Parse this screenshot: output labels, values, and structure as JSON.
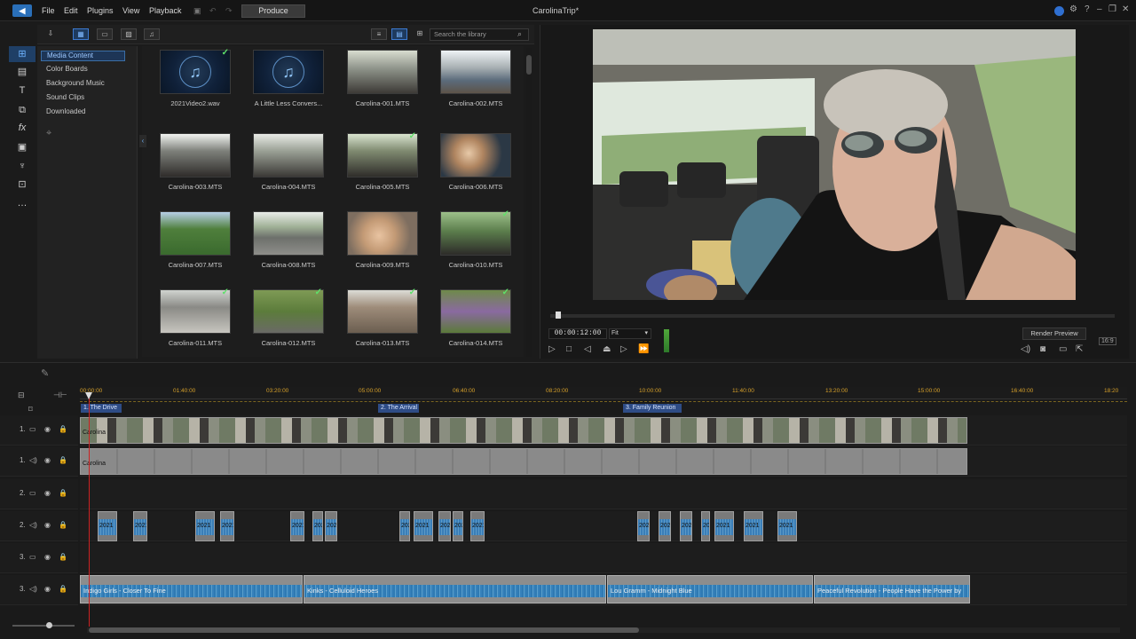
{
  "app": {
    "title": "CarolinaTrip*"
  },
  "menu": {
    "items": [
      "File",
      "Edit",
      "Plugins",
      "View",
      "Playback"
    ],
    "produce": "Produce"
  },
  "library": {
    "tree": [
      "Media Content",
      "Color Boards",
      "Background Music",
      "Sound Clips",
      "Downloaded"
    ],
    "search_placeholder": "Search the library",
    "items": [
      {
        "label": "2021Video2.wav",
        "type": "music"
      },
      {
        "label": "A Little Less Convers...",
        "type": "music"
      },
      {
        "label": "Carolina-001.MTS",
        "type": "video"
      },
      {
        "label": "Carolina-002.MTS",
        "type": "video"
      },
      {
        "label": "Carolina-003.MTS",
        "type": "video"
      },
      {
        "label": "Carolina-004.MTS",
        "type": "video"
      },
      {
        "label": "Carolina-005.MTS",
        "type": "video"
      },
      {
        "label": "Carolina-006.MTS",
        "type": "video"
      },
      {
        "label": "Carolina-007.MTS",
        "type": "video"
      },
      {
        "label": "Carolina-008.MTS",
        "type": "video"
      },
      {
        "label": "Carolina-009.MTS",
        "type": "video"
      },
      {
        "label": "Carolina-010.MTS",
        "type": "video"
      },
      {
        "label": "Carolina-011.MTS",
        "type": "video"
      },
      {
        "label": "Carolina-012.MTS",
        "type": "video"
      },
      {
        "label": "Carolina-013.MTS",
        "type": "video"
      },
      {
        "label": "Carolina-014.MTS",
        "type": "video"
      }
    ]
  },
  "preview": {
    "timecode": "00:00:12:00",
    "fit": "Fit",
    "render_preview": "Render Preview",
    "aspect": "16:9"
  },
  "timeline": {
    "ruler": [
      "00:00:00",
      "01:40:00",
      "03:20:00",
      "05:00:00",
      "06:40:00",
      "08:20:00",
      "10:00:00",
      "11:40:00",
      "13:20:00",
      "15:00:00",
      "16:40:00",
      "18:20"
    ],
    "chapters": [
      "1. The Drive",
      "2. The Arrival",
      "3. Family Reunion"
    ],
    "tracks": [
      "1.",
      "1.",
      "2.",
      "2.",
      "3.",
      "3."
    ],
    "music_clips": [
      "Indigo Girls - Closer To Fine",
      "Kinks - Celluloid Heroes",
      "Lou Gramm - Midnight Blue",
      "Peaceful Revolution - People Have the Power by"
    ],
    "video_clip_label": "Carolina",
    "small_clip_label": "2021"
  }
}
